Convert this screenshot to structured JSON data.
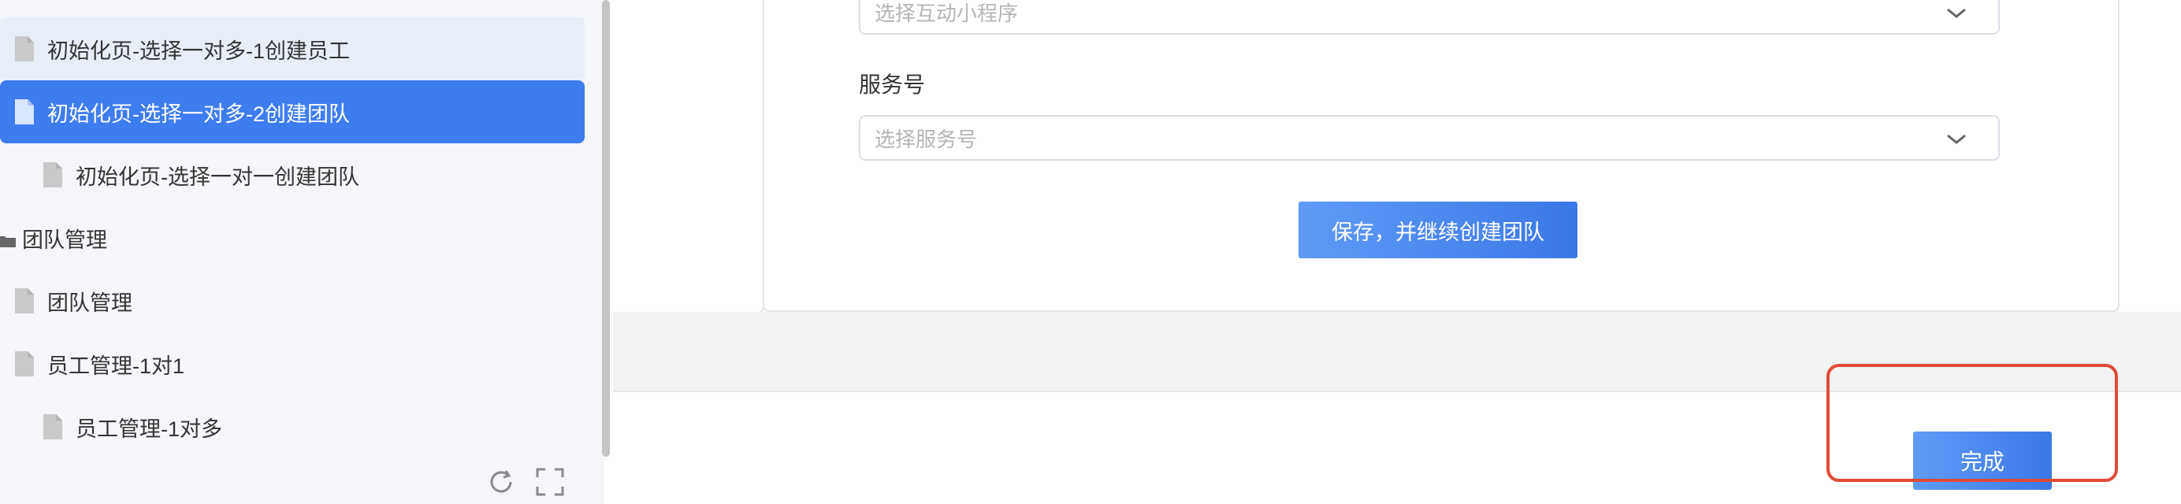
{
  "sidebar": {
    "items": [
      {
        "label": "初始化页-选择一对多-1创建员工"
      },
      {
        "label": "初始化页-选择一对多-2创建团队"
      },
      {
        "label": "初始化页-选择一对一创建团队"
      },
      {
        "label": "团队管理"
      },
      {
        "label": "团队管理"
      },
      {
        "label": "员工管理-1对1"
      },
      {
        "label": "员工管理-1对多"
      }
    ],
    "tools": {
      "refresh_icon": "refresh-icon",
      "fullscreen_icon": "fullscreen-icon"
    }
  },
  "form": {
    "mini_program": {
      "placeholder": "选择互动小程序"
    },
    "service_account": {
      "label": "服务号",
      "placeholder": "选择服务号"
    },
    "save_button": "保存，并继续创建团队"
  },
  "footer": {
    "done_button": "完成"
  },
  "colors": {
    "accent": "#3e7df0",
    "highlight": "#e04a38"
  }
}
